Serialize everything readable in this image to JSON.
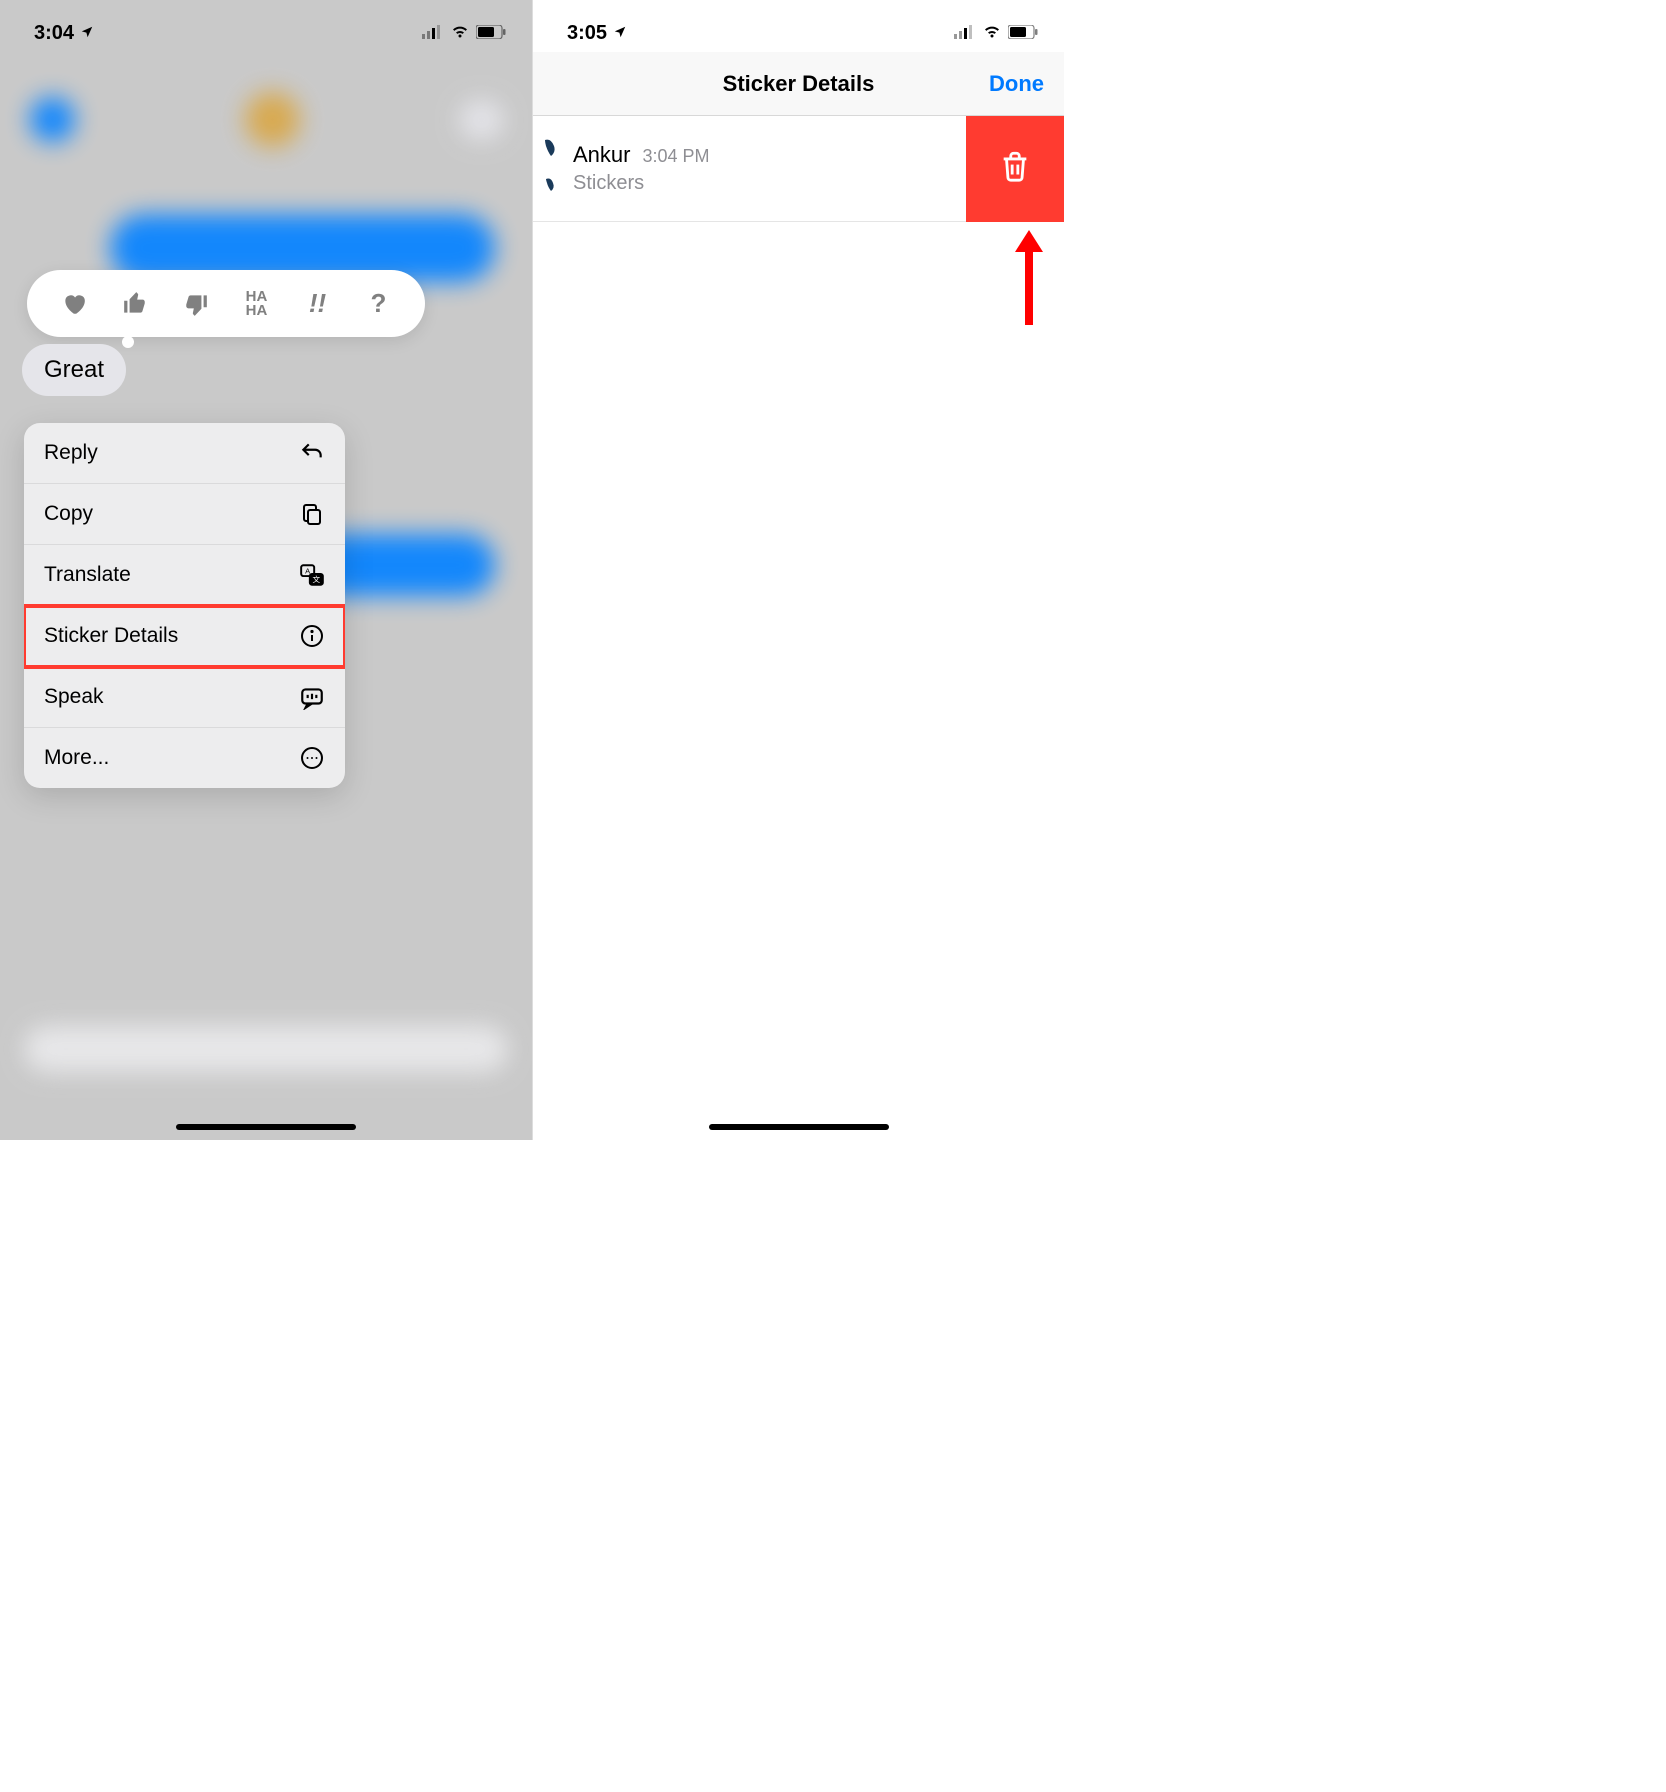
{
  "left": {
    "status": {
      "time": "3:04"
    },
    "message": "Great",
    "menu": {
      "reply": "Reply",
      "copy": "Copy",
      "translate": "Translate",
      "sticker_details": "Sticker Details",
      "speak": "Speak",
      "more": "More..."
    },
    "reactions": [
      "heart",
      "thumbs-up",
      "thumbs-down",
      "haha",
      "exclaim",
      "question"
    ]
  },
  "right": {
    "status": {
      "time": "3:05"
    },
    "header": {
      "title": "Sticker Details",
      "done": "Done"
    },
    "row": {
      "name": "Ankur",
      "time": "3:04 PM",
      "sub": "Stickers"
    }
  }
}
